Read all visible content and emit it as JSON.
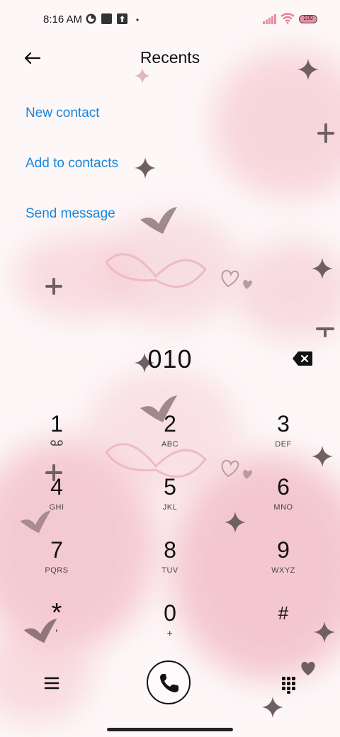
{
  "status_bar": {
    "time": "8:16 AM",
    "battery": "100",
    "icons": [
      "notification-icon",
      "square-icon",
      "upload-icon",
      "dot-icon",
      "signal-icon",
      "wifi-icon",
      "battery-icon"
    ]
  },
  "header": {
    "title": "Recents",
    "back_icon": "back-arrow-icon"
  },
  "actions": [
    {
      "label": "New contact"
    },
    {
      "label": "Add to contacts"
    },
    {
      "label": "Send message"
    }
  ],
  "dialer": {
    "number": "010",
    "keys": [
      {
        "digit": "1",
        "letters": ""
      },
      {
        "digit": "2",
        "letters": "ABC"
      },
      {
        "digit": "3",
        "letters": "DEF"
      },
      {
        "digit": "4",
        "letters": "GHI"
      },
      {
        "digit": "5",
        "letters": "JKL"
      },
      {
        "digit": "6",
        "letters": "MNO"
      },
      {
        "digit": "7",
        "letters": "PQRS"
      },
      {
        "digit": "8",
        "letters": "TUV"
      },
      {
        "digit": "9",
        "letters": "WXYZ"
      },
      {
        "digit": "*",
        "letters": ","
      },
      {
        "digit": "0",
        "letters": "+"
      },
      {
        "digit": "#",
        "letters": ""
      }
    ]
  },
  "colors": {
    "accent": "#1787de",
    "text": "#111111",
    "background": "#fdf7f8",
    "wallpaper_pink": "#f4c4cc"
  }
}
